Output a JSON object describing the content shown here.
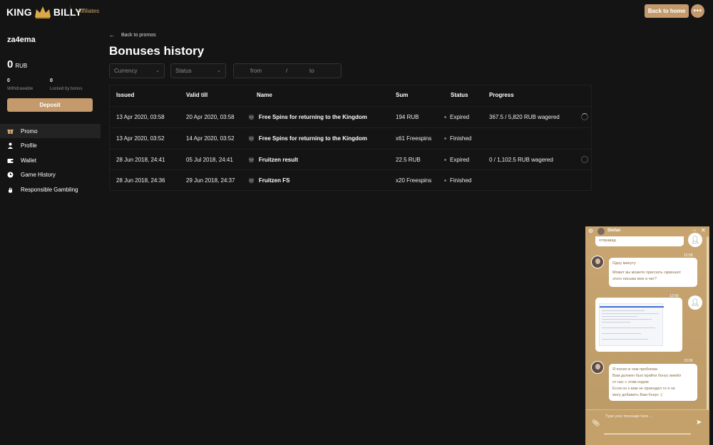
{
  "header": {
    "logo_left": "KING",
    "logo_right": "BILLY",
    "affiliates": "Affiliates",
    "back_home": "Back to home",
    "more": "•••"
  },
  "sidebar": {
    "username": "za4ema",
    "balance_value": "0",
    "balance_currency": "RUB",
    "withdrawable_value": "0",
    "withdrawable_label": "Withdrawable",
    "locked_value": "0",
    "locked_label": "Locked by bonus",
    "deposit": "Deposit",
    "items": [
      {
        "label": "Promo",
        "icon": "gift-icon",
        "active": true
      },
      {
        "label": "Profile",
        "icon": "user-icon",
        "active": false
      },
      {
        "label": "Wallet",
        "icon": "wallet-icon",
        "active": false
      },
      {
        "label": "Game History",
        "icon": "clock-icon",
        "active": false
      },
      {
        "label": "Responsible Gambling",
        "icon": "hand-icon",
        "active": false
      }
    ]
  },
  "main": {
    "back_label": "Back to promos",
    "title": "Bonuses history",
    "filters": {
      "currency": "Currency",
      "status": "Status",
      "from": "from",
      "sep": "/",
      "to": "to"
    },
    "columns": [
      "Issued",
      "Valid till",
      "Name",
      "Sum",
      "Status",
      "Progress"
    ],
    "rows": [
      {
        "issued": "13 Apr 2020, 03:58",
        "valid": "20 Apr 2020, 03:58",
        "name": "Free Spins for returning to the Kingdom",
        "sum": "194 RUB",
        "status": "Expired",
        "progress": "367.5 / 5,820 RUB wagered",
        "ring": true
      },
      {
        "issued": "13 Apr 2020, 03:52",
        "valid": "14 Apr 2020, 03:52",
        "name": "Free Spins for returning to the Kingdom",
        "sum": "x61 Freespins",
        "status": "Finished",
        "progress": "",
        "ring": false
      },
      {
        "issued": "28 Jun 2018, 24:41",
        "valid": "05 Jul 2018, 24:41",
        "name": "Fruitzen result",
        "sum": "22.5 RUB",
        "status": "Expired",
        "progress": "0 / 1,102.5 RUB wagered",
        "ring": true
      },
      {
        "issued": "28 Jun 2018, 24:36",
        "valid": "29 Jun 2018, 24:37",
        "name": "Fruitzen FS",
        "sum": "x20 Freespins",
        "status": "Finished",
        "progress": "",
        "ring": false
      }
    ]
  },
  "chat": {
    "agent_name": "Stefan",
    "messages": {
      "user_top": "отправид",
      "ts1": "12:58",
      "op1_line1": "Одну минуту",
      "op1_line2": "Может вы можете прислать скриншот",
      "op1_line3": "этого письма мне в чат?",
      "ts2": "12:59",
      "ts3": "13:00",
      "op2_line1": "Я понял в чем проблема",
      "op2_line2": "Вам должен был прийти бонус имейл",
      "op2_line3": "от нас с этим кодом",
      "op2_line4": "Если он к вам не приходил то я не",
      "op2_line5": "могу добавить Вам бонус :("
    },
    "input_placeholder": "Type your message here ..."
  },
  "colors": {
    "accent": "#c49a6c",
    "background": "#141414",
    "chat_bg": "#c3a06c"
  }
}
